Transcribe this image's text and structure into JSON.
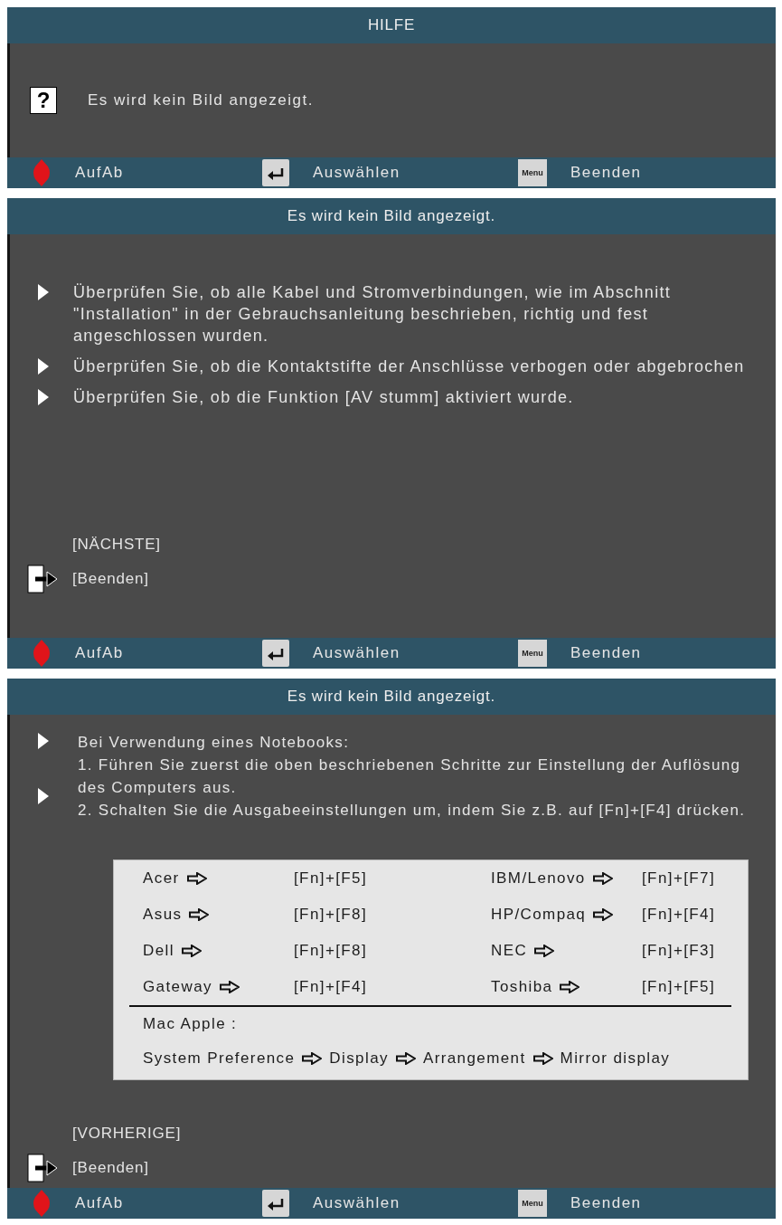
{
  "panels": [
    {
      "title": "HILFE",
      "menu_items": [
        {
          "icon": "?",
          "text": "Es wird kein Bild angezeigt."
        }
      ],
      "footer": [
        {
          "kind": "updown",
          "label": "AufAb"
        },
        {
          "kind": "enter",
          "label": "Auswählen"
        },
        {
          "kind": "menu",
          "key": "Menu",
          "label": "Beenden"
        }
      ]
    },
    {
      "title": "Es wird kein Bild angezeigt.",
      "bullets": [
        {
          "lines": [
            "Überprüfen Sie, ob alle Kabel und Stromverbindungen, wie im Abschnitt \"Installation\" in der Gebrauchsanleitung beschrieben, richtig und fest angeschlossen wurden."
          ]
        },
        {
          "lines": [
            "Überprüfen Sie, ob die Kontaktstifte der Anschlüsse verbogen oder abgebrochen"
          ]
        },
        {
          "lines": [
            "Überprüfen Sie, ob die Funktion [AV stumm] aktiviert wurde."
          ]
        }
      ],
      "nav": [
        {
          "kind": "page",
          "label": "[NÄCHSTE]"
        },
        {
          "kind": "exit",
          "label": "[Beenden]"
        }
      ],
      "footer": [
        {
          "kind": "updown",
          "label": "AufAb"
        },
        {
          "kind": "enter",
          "label": "Auswählen"
        },
        {
          "kind": "menu",
          "key": "Menu",
          "label": "Beenden"
        }
      ]
    },
    {
      "title": "Es wird kein Bild angezeigt.",
      "bullets": [
        {
          "lines": [
            "Bei Verwendung eines Notebooks:",
            "1. Führen Sie zuerst die oben beschriebenen Schritte zur Einstellung der Auflösung des Computers aus."
          ]
        },
        {
          "lines": [
            "2. Schalten Sie die Ausgabeeinstellungen um, indem Sie z.B. auf [Fn]+[F4] drücken."
          ]
        }
      ],
      "shortcut_table": {
        "rows": [
          [
            {
              "brand": "Acer",
              "keys": "[Fn]+[F5]"
            },
            {
              "brand": "IBM/Lenovo",
              "keys": "[Fn]+[F7]"
            }
          ],
          [
            {
              "brand": "Asus",
              "keys": "[Fn]+[F8]"
            },
            {
              "brand": "HP/Compaq",
              "keys": "[Fn]+[F4]"
            }
          ],
          [
            {
              "brand": "Dell",
              "keys": "[Fn]+[F8]"
            },
            {
              "brand": "NEC",
              "keys": "[Fn]+[F3]"
            }
          ],
          [
            {
              "brand": "Gateway",
              "keys": "[Fn]+[F4]"
            },
            {
              "brand": "Toshiba",
              "keys": "[Fn]+[F5]"
            }
          ]
        ],
        "mac_label": "Mac Apple :",
        "mac_path": [
          "System Preference",
          "Display",
          "Arrangement",
          "Mirror display"
        ]
      },
      "nav": [
        {
          "kind": "page",
          "label": "[VORHERIGE]"
        },
        {
          "kind": "exit",
          "label": "[Beenden]"
        }
      ],
      "footer": [
        {
          "kind": "updown",
          "label": "AufAb"
        },
        {
          "kind": "enter",
          "label": "Auswählen"
        },
        {
          "kind": "menu",
          "key": "Menu",
          "label": "Beenden"
        }
      ]
    }
  ]
}
